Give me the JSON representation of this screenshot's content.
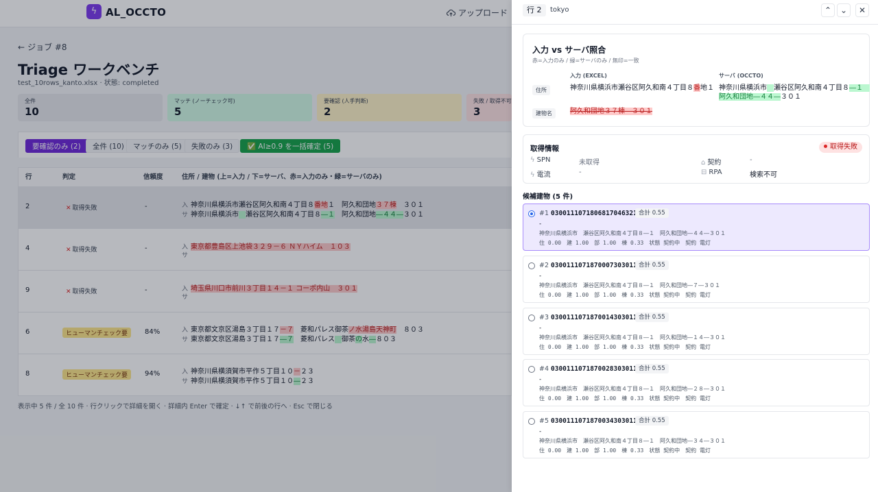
{
  "app": {
    "brand": "AL_OCCTO",
    "upload_label": "アップロード"
  },
  "page": {
    "back_label": "ジョブ #8",
    "title": "Triage ワークベンチ",
    "subtitle": "test_10rows_kanto.xlsx · 状態: completed"
  },
  "stats": [
    {
      "label": "全件",
      "value": "10",
      "color": "#e5e7eb"
    },
    {
      "label": "マッチ (ノーチェック可)",
      "value": "5",
      "color": "#d1fae5"
    },
    {
      "label": "要確認 (人手判断)",
      "value": "2",
      "color": "#fef3c7"
    },
    {
      "label": "失敗 / 取得不可",
      "value": "3",
      "color": "#fee2e2"
    }
  ],
  "filters": {
    "needs_review": "要確認のみ (2)",
    "all": "全件 (10)",
    "match_only": "マッチのみ (5)",
    "failed_only": "失敗のみ (3)",
    "bulk_confirm": "✅ AI≥0.9 を一括確定 (5)"
  },
  "table": {
    "headers": {
      "row": "行",
      "verdict": "判定",
      "confidence": "信頼度",
      "address": "住所 / 建物 (上=入力 / 下=サーバ、赤=入力のみ・緑=サーバのみ)"
    },
    "prefix_in": "入",
    "prefix_sv": "サ",
    "rows": [
      {
        "row": "2",
        "verdict": "取得失敗",
        "confidence": "-",
        "in": [
          "神奈川県横浜市瀬谷区阿久和南４丁目８",
          "番地",
          "１　阿久和団地",
          "３７棟",
          "　３０１"
        ],
        "sv": [
          "神奈川県横浜市",
          "　",
          "瀬谷区阿久和南４丁目８",
          "―１",
          "　阿久和団地",
          "―４４―",
          "３０１"
        ]
      },
      {
        "row": "4",
        "verdict": "取得失敗",
        "confidence": "-",
        "in": [
          "東京都豊島区上池袋３２９－６ ＮＹハイム　１０３"
        ],
        "sv": []
      },
      {
        "row": "9",
        "verdict": "取得失敗",
        "confidence": "-",
        "in": [
          "埼玉県川口市前川３丁目１４－１ コーポ内山　３０１"
        ],
        "sv": []
      },
      {
        "row": "6",
        "verdict": "ヒューマンチェック要",
        "confidence": "84%",
        "in": [
          "東京都文京区湯島３丁目１７",
          "－７",
          "　菱和パレス御茶",
          "ノ水湯島天神町",
          "　８０３"
        ],
        "sv": [
          "東京都文京区湯島３丁目１７",
          "―７",
          "　菱和パレス",
          "　",
          "御茶",
          "の",
          "水",
          "―",
          "８０３"
        ]
      },
      {
        "row": "8",
        "verdict": "ヒューマンチェック要",
        "confidence": "94%",
        "in": [
          "神奈川県横須賀市平作５丁目１０",
          "－",
          "２３"
        ],
        "sv": [
          "神奈川県横須賀市平作５丁目１０",
          "―",
          "２３"
        ]
      }
    ]
  },
  "footnote": "表示中 5 件 / 全 10 件 · 行クリックで詳細を開く · 詳細内 Enter で確定 · ↓↑ で前後の行へ · Esc で閉じる",
  "drawer": {
    "row_tag": "行 2",
    "city": "tokyo",
    "compare": {
      "title": "入力 vs サーバ照合",
      "legend": "赤=入力のみ / 緑=サーバのみ / 無印=一致",
      "col_input": "入力 (EXCEL)",
      "col_server": "サーバ (OCCTO)",
      "label_address": "住所",
      "label_building": "建物名",
      "in_addr_a": "神奈川県横浜市瀬谷区阿久和南４丁目８",
      "in_addr_red": "番",
      "in_addr_b": "地１",
      "sv_addr_a": "神奈川県横浜市",
      "sv_addr_g1": "　",
      "sv_addr_b": "瀬谷区阿久和南４丁目８",
      "sv_addr_g2": "―１　阿",
      "sv_addr_g3": "久和団地",
      "sv_addr_g4": "―４４―",
      "sv_addr_c": "３０１",
      "in_building": "阿久和団地３７棟　３０１"
    },
    "acquire": {
      "title": "取得情報",
      "status": "取得失敗",
      "spn_label": "SPN",
      "spn_value": "未取得",
      "contract_label": "契約",
      "contract_value": "-",
      "power_label": "電流",
      "power_value": "-",
      "rpa_label": "RPA",
      "rpa_value": "検索不可"
    },
    "candidates_title": "候補建物 (5 件)",
    "candidates": [
      {
        "num": "#1",
        "id": "0300111071806817046321",
        "score": "合計 0.55",
        "dash": "-",
        "addr": "神奈川県横浜市　瀬谷区阿久和南４丁目８―１　阿久和団地―４４―３０１",
        "meta": "住 0.00　建 1.00　部 1.00　棟 0.33　状態 契約中　契約 電灯"
      },
      {
        "num": "#2",
        "id": "0300111071870007303011",
        "score": "合計 0.55",
        "dash": "-",
        "addr": "神奈川県横浜市　瀬谷区阿久和南４丁目８―１　阿久和団地―７―３０１",
        "meta": "住 0.00　建 1.00　部 1.00　棟 0.33　状態 契約中　契約 電灯"
      },
      {
        "num": "#3",
        "id": "0300111071870014303011",
        "score": "合計 0.55",
        "dash": "-",
        "addr": "神奈川県横浜市　瀬谷区阿久和南４丁目８―１　阿久和団地―１４―３０１",
        "meta": "住 0.00　建 1.00　部 1.00　棟 0.33　状態 契約中　契約 電灯"
      },
      {
        "num": "#4",
        "id": "0300111071870028303011",
        "score": "合計 0.55",
        "dash": "-",
        "addr": "神奈川県横浜市　瀬谷区阿久和南４丁目８―１　阿久和団地―２８―３０１",
        "meta": "住 0.00　建 1.00　部 1.00　棟 0.33　状態 契約中　契約 電灯"
      },
      {
        "num": "#5",
        "id": "0300111071870034303011",
        "score": "合計 0.55",
        "dash": "-",
        "addr": "神奈川県横浜市　瀬谷区阿久和南４丁目８―１　阿久和団地―３４―３０１",
        "meta": "住 0.00　建 1.00　部 1.00　棟 0.33　状態 契約中　契約 電灯"
      }
    ]
  }
}
